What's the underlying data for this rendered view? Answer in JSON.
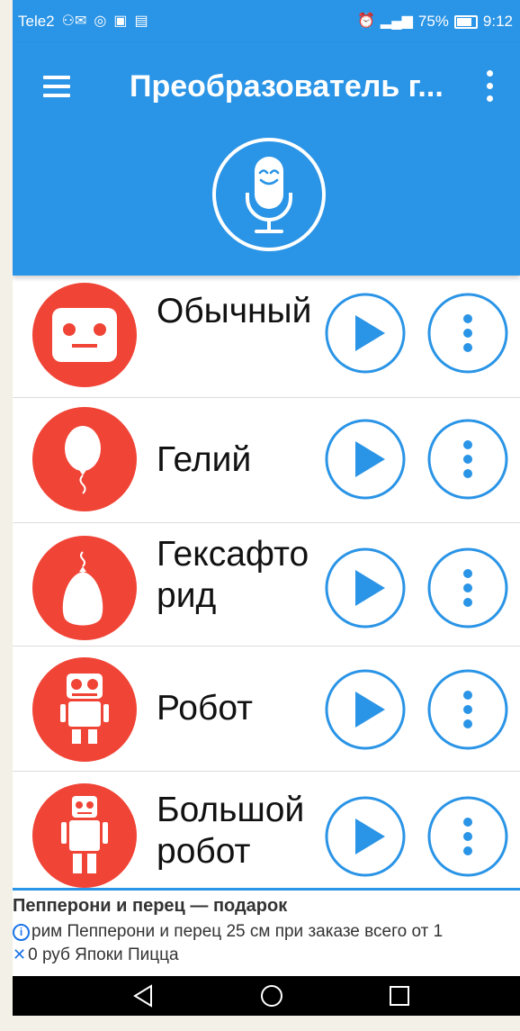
{
  "status_bar": {
    "carrier": "Tele2",
    "battery": "75%",
    "time": "9:12"
  },
  "header": {
    "title": "Преобразователь г..."
  },
  "voices": [
    {
      "name": "Обычный",
      "icon": "robot-face-icon"
    },
    {
      "name": "Гелий",
      "icon": "balloon-icon"
    },
    {
      "name": "Гексафторид",
      "icon": "heavy-balloon-icon"
    },
    {
      "name": "Робот",
      "icon": "robot-icon"
    },
    {
      "name": "Большой робот",
      "icon": "big-robot-icon"
    }
  ],
  "ad": {
    "title": "Пепперони и перец — подарок",
    "line1": "рим Пепперони и перец 25 см при заказе всего от 1",
    "line2": "0 руб Япоки Пицца"
  },
  "colors": {
    "accent": "#2a94e6",
    "avatar_red": "#f04436",
    "text": "#111111"
  }
}
